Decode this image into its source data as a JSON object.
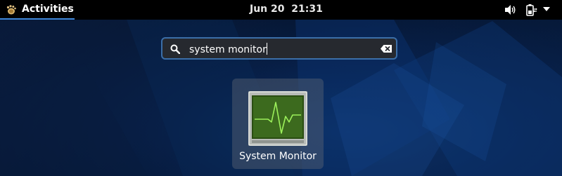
{
  "topbar": {
    "activities_label": "Activities",
    "clock": "Jun 20  21:31",
    "tray_icons": [
      "volume-icon",
      "battery-icon",
      "system-menu-chevron-icon"
    ]
  },
  "search": {
    "value": "system monitor",
    "icon": "search-icon",
    "clear_icon": "clear-text-icon"
  },
  "results": [
    {
      "name": "System Monitor",
      "icon": "system-monitor-icon"
    }
  ],
  "colors": {
    "topbar": "#000000",
    "accent": "#3f86d8",
    "search_bg": "#26292f",
    "search_border": "#3b6ea8",
    "monitor_screen": "#3c6a1e",
    "monitor_trace": "#9cf05a"
  }
}
